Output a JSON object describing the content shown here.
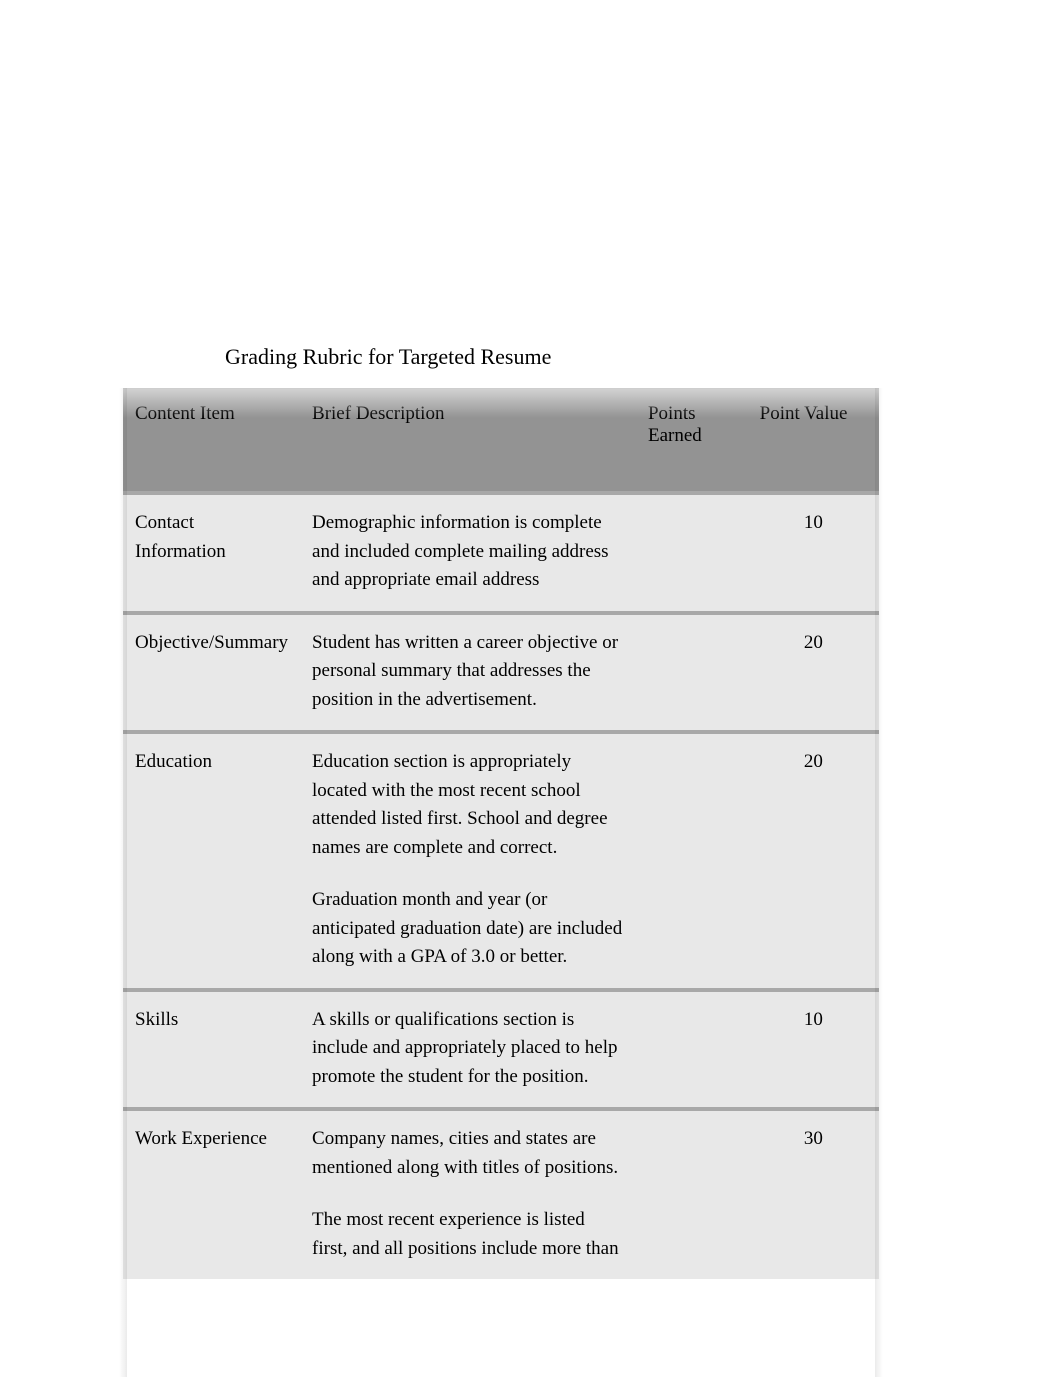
{
  "title": "Grading Rubric for Targeted Resume",
  "headers": {
    "item": "Content Item",
    "description": "Brief Description",
    "earned": "Points Earned",
    "value": "Point Value"
  },
  "rows": [
    {
      "item": "Contact Information",
      "description_p1": "Demographic information is complete and included complete mailing address and appropriate email address",
      "earned": "",
      "value": "10"
    },
    {
      "item": "Objective/Summary",
      "description_p1": "Student has written a career objective or personal summary that addresses the position in the advertisement.",
      "earned": "",
      "value": "20"
    },
    {
      "item": "Education",
      "description_p1": "Education section is appropriately located with the most recent school attended listed first. School and degree names are complete and correct.",
      "description_p2": "Graduation month and year (or anticipated graduation date) are included along with a GPA of 3.0 or better.",
      "earned": "",
      "value": "20"
    },
    {
      "item": "Skills",
      "description_p1": "A skills or qualifications section is include and appropriately placed to help promote the student for the position.",
      "earned": "",
      "value": "10"
    },
    {
      "item": "Work Experience",
      "description_p1": "Company names, cities and states are mentioned along with titles of positions.",
      "description_p2": "The most recent experience is listed first, and all positions include more than",
      "earned": "",
      "value": "30"
    }
  ]
}
